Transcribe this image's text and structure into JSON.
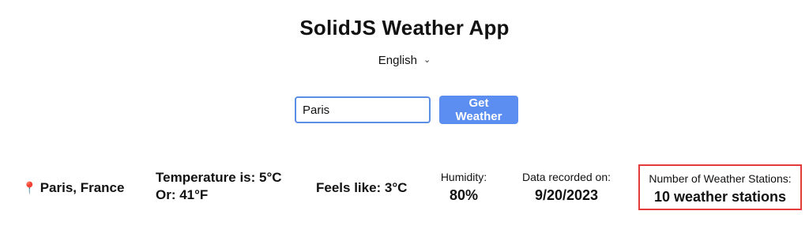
{
  "app": {
    "title": "SolidJS Weather App"
  },
  "language": {
    "selected": "English"
  },
  "search": {
    "value": "Paris",
    "button_label": "Get Weather"
  },
  "weather": {
    "location": "Paris, France",
    "temperature_c": "Temperature is: 5°C",
    "temperature_f": "Or: 41°F",
    "feels_like": "Feels like: 3°C",
    "humidity_label": "Humidity:",
    "humidity_value": "80%",
    "recorded_label": "Data recorded on:",
    "recorded_value": "9/20/2023",
    "stations_label": "Number of Weather Stations:",
    "stations_value": "10 weather stations"
  },
  "icons": {
    "location": "map-pin-icon",
    "language_dropdown": "chevron-down-icon"
  },
  "colors": {
    "accent": "#5b8ef0",
    "highlight_border": "#e53a3a",
    "pin": "#d9362b"
  }
}
